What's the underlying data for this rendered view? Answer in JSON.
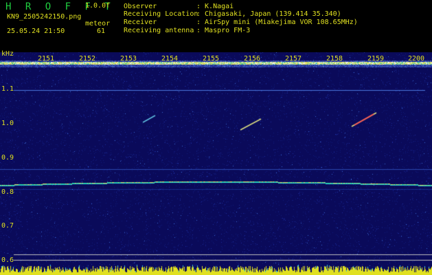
{
  "header": {
    "app_title": "H R O F F T",
    "version": "1.0.0f",
    "filename": "KN9_2505242150.png",
    "mode": "meteor",
    "datetime": "25.05.24 21:50",
    "count": "61"
  },
  "metadata": [
    {
      "label": "Observer",
      "value": ": K.Nagai"
    },
    {
      "label": "Receiving Location",
      "value": ": Chigasaki, Japan (139.414 35.340)"
    },
    {
      "label": "Receiver",
      "value": ": AirSpy mini (Miakejima VOR 108.65MHz)"
    },
    {
      "label": "Receiving antenna",
      "value": ": Maspro FM-3"
    }
  ],
  "y_axis": {
    "unit": "kHz",
    "ticks": [
      "1.1",
      "1.0",
      "0.9",
      "0.8",
      "0.7",
      "0.6"
    ]
  },
  "time_axis": {
    "ticks": [
      "2151",
      "2152",
      "2153",
      "2154",
      "2155",
      "2156",
      "2157",
      "2158",
      "2159",
      "2200"
    ]
  },
  "colors": {
    "text_yellow": "#e0e020",
    "title_green": "#20d040",
    "background_blue": "#0a0a5a",
    "carrier_line": "#20c0d0"
  }
}
